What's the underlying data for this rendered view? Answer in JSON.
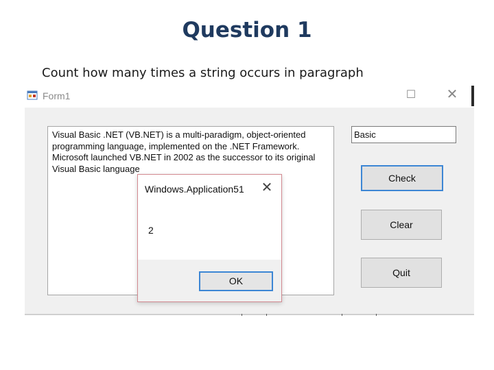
{
  "slide": {
    "title": "Question 1",
    "subtitle": "Count how many times a string  occurs in paragraph"
  },
  "form": {
    "title": "Form1",
    "paragraph_text": "Visual Basic .NET (VB.NET) is a multi-paradigm, object-oriented\nprogramming language, implemented on the .NET Framework.\nMicrosoft launched VB.NET in 2002 as the successor to its original\nVisual Basic language",
    "search_value": "Basic",
    "buttons": {
      "check": "Check",
      "clear": "Clear",
      "quit": "Quit"
    }
  },
  "message_box": {
    "title": "Windows.Application51",
    "message": "2",
    "ok_label": "OK"
  },
  "icons": {
    "maximize": "maximize-icon",
    "close": "close-icon",
    "app": "app-icon"
  }
}
